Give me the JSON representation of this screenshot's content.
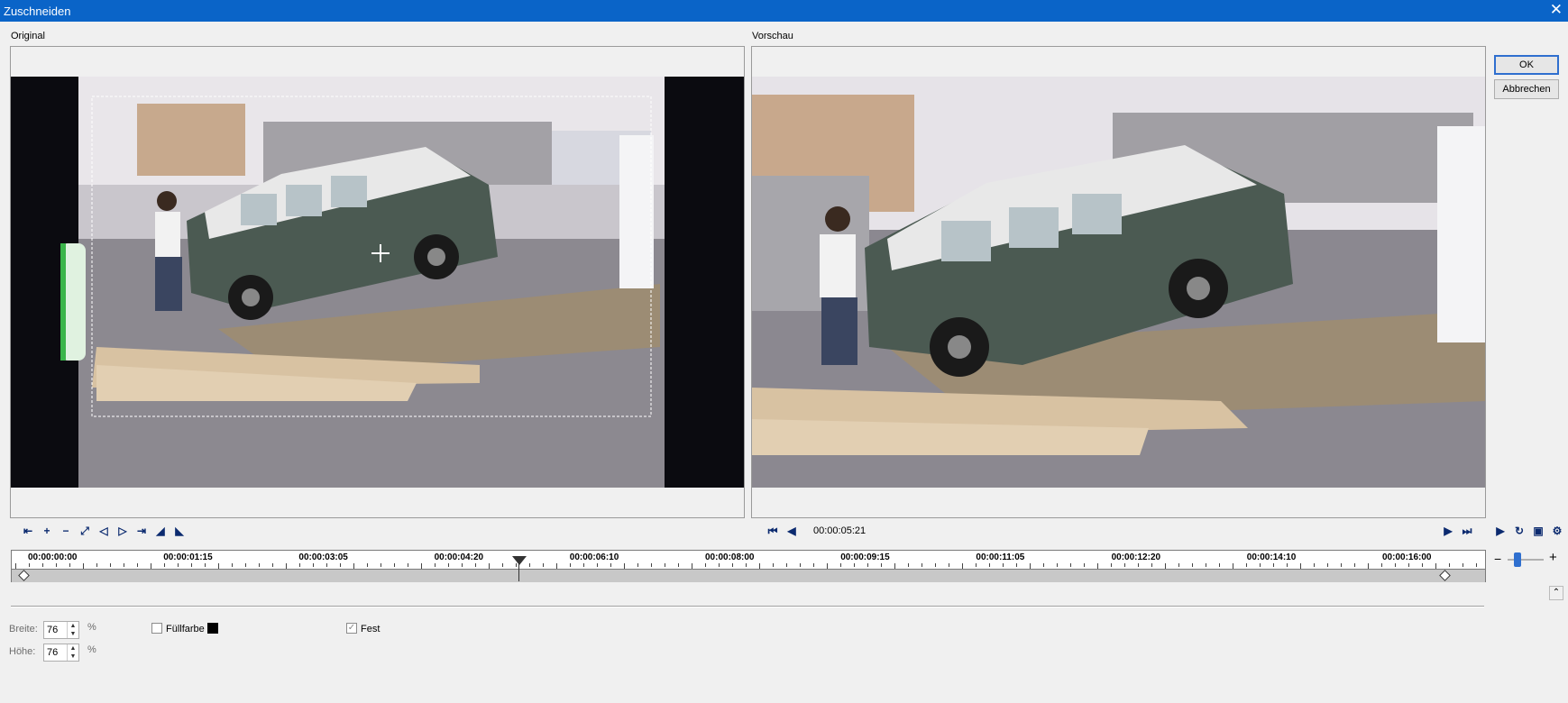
{
  "window": {
    "title": "Zuschneiden"
  },
  "panes": {
    "original_label": "Original",
    "preview_label": "Vorschau"
  },
  "buttons": {
    "ok": "OK",
    "cancel": "Abbrechen"
  },
  "playback": {
    "current_time": "00:00:05:21"
  },
  "timeline": {
    "ticks": [
      "00:00:00:00",
      "00:00:01:15",
      "00:00:03:05",
      "00:00:04:20",
      "00:00:06:10",
      "00:00:08:00",
      "00:00:09:15",
      "00:00:11:05",
      "00:00:12:20",
      "00:00:14:10",
      "00:00:16:00"
    ]
  },
  "settings": {
    "width_label": "Breite:",
    "width_value": "76",
    "width_unit": "%",
    "height_label": "Höhe:",
    "height_value": "76",
    "height_unit": "%",
    "fill_label": "Füllfarbe",
    "fill_color": "#000000",
    "fixed_label": "Fest",
    "fixed_checked": true,
    "fill_checked": false
  },
  "colors": {
    "titlebar": "#0a64c8",
    "accent": "#2f6fcf"
  }
}
